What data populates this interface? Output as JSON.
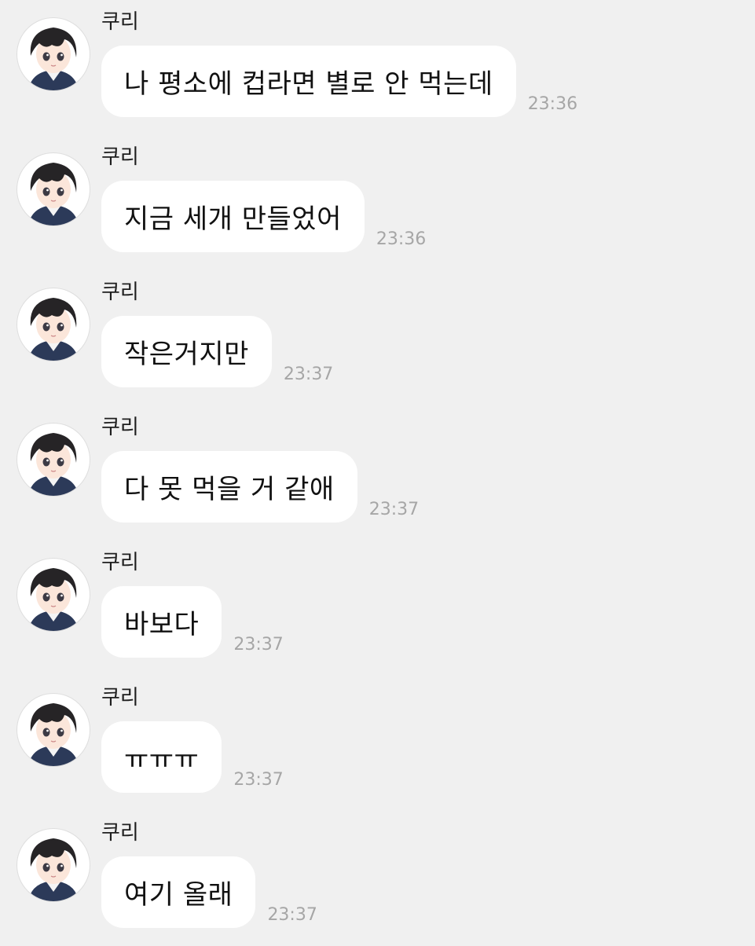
{
  "messages": [
    {
      "sender": "쿠리",
      "text": "나 평소에 컵라면 별로 안 먹는데",
      "time": "23:36"
    },
    {
      "sender": "쿠리",
      "text": "지금 세개 만들었어",
      "time": "23:36"
    },
    {
      "sender": "쿠리",
      "text": "작은거지만",
      "time": "23:37"
    },
    {
      "sender": "쿠리",
      "text": "다 못 먹을 거 같애",
      "time": "23:37"
    },
    {
      "sender": "쿠리",
      "text": "바보다",
      "time": "23:37"
    },
    {
      "sender": "쿠리",
      "text": "ㅠㅠㅠ",
      "time": "23:37"
    },
    {
      "sender": "쿠리",
      "text": "여기 올래",
      "time": "23:37"
    }
  ],
  "colors": {
    "background": "#f0f0f0",
    "bubble": "#ffffff",
    "time": "#a6a6a6",
    "text": "#111111"
  },
  "icons": {
    "avatar": "profile-avatar-icon"
  }
}
